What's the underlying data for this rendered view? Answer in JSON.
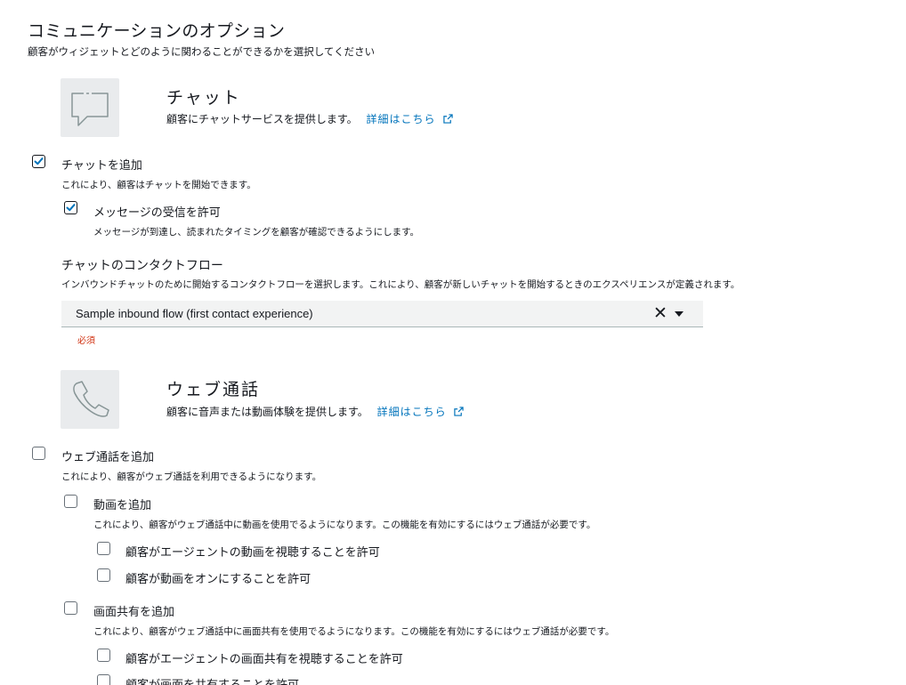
{
  "header": {
    "title": "コミュニケーションのオプション",
    "subtitle": "顧客がウィジェットとどのように関わることができるかを選択してください"
  },
  "chat": {
    "title": "チャット",
    "desc": "顧客にチャットサービスを提供します。",
    "link": "詳細はこちら",
    "add_label": "チャットを追加",
    "add_desc": "これにより、顧客はチャットを開始できます。",
    "add_checked": true,
    "receipt_label": "メッセージの受信を許可",
    "receipt_desc": "メッセージが到達し、読まれたタイミングを顧客が確認できるようにします。",
    "receipt_checked": true,
    "flow_heading": "チャットのコンタクトフロー",
    "flow_desc": "インバウンドチャットのために開始するコンタクトフローを選択します。これにより、顧客が新しいチャットを開始するときのエクスペリエンスが定義されます。",
    "flow_value": "Sample inbound flow (first contact experience)",
    "flow_clear": "✕",
    "required": "必須"
  },
  "webcall": {
    "title": "ウェブ通話",
    "desc": "顧客に音声または動画体験を提供します。",
    "link": "詳細はこちら",
    "add_label": "ウェブ通話を追加",
    "add_desc": "これにより、顧客がウェブ通話を利用できるようになります。",
    "video_label": "動画を追加",
    "video_desc": "これにより、顧客がウェブ通話中に動画を使用でるようになります。この機能を有効にするにはウェブ通話が必要です。",
    "video_opt1": "顧客がエージェントの動画を視聴することを許可",
    "video_opt2": "顧客が動画をオンにすることを許可",
    "share_label": "画面共有を追加",
    "share_desc": "これにより、顧客がウェブ通話中に画面共有を使用でるようになります。この機能を有効にするにはウェブ通話が必要です。",
    "share_opt1": "顧客がエージェントの画面共有を視聴することを許可",
    "share_opt2": "顧客が画面を共有することを許可"
  },
  "icons": {
    "chat": "chat-bubble-icon",
    "phone": "phone-icon",
    "external": "external-link-icon",
    "check": "check-icon"
  },
  "colors": {
    "link": "#0073bb",
    "checkbox_checked": "#0073bb",
    "required": "#d13212",
    "tile_bg": "#e9ebed"
  }
}
